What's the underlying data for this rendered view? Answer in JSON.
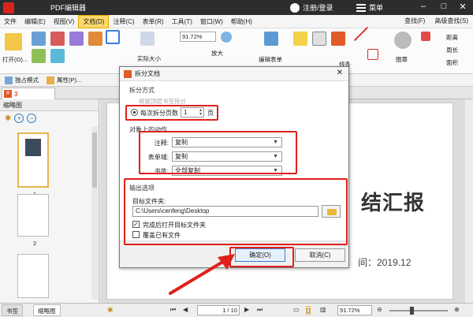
{
  "window": {
    "title": "PDF编辑器",
    "user": "注册/登录",
    "menu": "菜单"
  },
  "menubar": {
    "items": [
      "文件",
      "编辑(E)",
      "视图(V)",
      "文档(D)",
      "注释(C)",
      "表单(R)",
      "工具(T)",
      "窗口(W)",
      "帮助(H)"
    ],
    "active_index": 3,
    "right": [
      "查找(F)",
      "高级查找(S)"
    ]
  },
  "ribbon": {
    "open_label": "打开(O)...",
    "zoom_value": "91.72%",
    "zoom_in_label": "放大",
    "actual_size_label": "实际大小",
    "edit_form_label": "编辑表单",
    "line_label": "线条",
    "stamp_label": "图章",
    "distance_label": "距离",
    "perimeter_label": "周长",
    "area_label": "面积"
  },
  "subbar": {
    "exclusive_mode": "独占模式",
    "properties": "属性(P)..."
  },
  "tab": {
    "num": "3"
  },
  "leftpanel": {
    "title": "缩略图",
    "thumbs": [
      "1",
      "2"
    ]
  },
  "page": {
    "big_text": "结汇报",
    "date_text": "间：2019.12"
  },
  "dialog": {
    "title": "拆分文档",
    "section_method": "拆分方式",
    "disabled_option": "根据顶层书签拆分",
    "pages_option": "每次拆分页数",
    "pages_value": "1",
    "pages_unit": "页",
    "section_objects": "对象上的动作",
    "annotations_label": "注释:",
    "annotations_value": "复制",
    "formfields_label": "表单域:",
    "formfields_value": "复制",
    "bookmarks_label": "书签:",
    "bookmarks_value": "全部复制",
    "section_output": "输出选项",
    "target_folder_label": "目标文件夹:",
    "target_folder_value": "C:\\Users\\cenfeng\\Desktop",
    "open_after_label": "完成后打开目标文件夹",
    "open_after_checked": true,
    "overwrite_label": "覆盖已有文件",
    "overwrite_checked": false,
    "ok_label": "确定(O)",
    "cancel_label": "取消(C)"
  },
  "bottombar": {
    "tabs": [
      "书签",
      "缩略图"
    ],
    "active_tab": 1,
    "page_input": "1",
    "page_total": "/ 10",
    "zoom_value": "91.72%"
  },
  "colors": {
    "highlight": "#e0201a",
    "accent": "#3b7dd8",
    "title_bg": "#2d2d30"
  }
}
